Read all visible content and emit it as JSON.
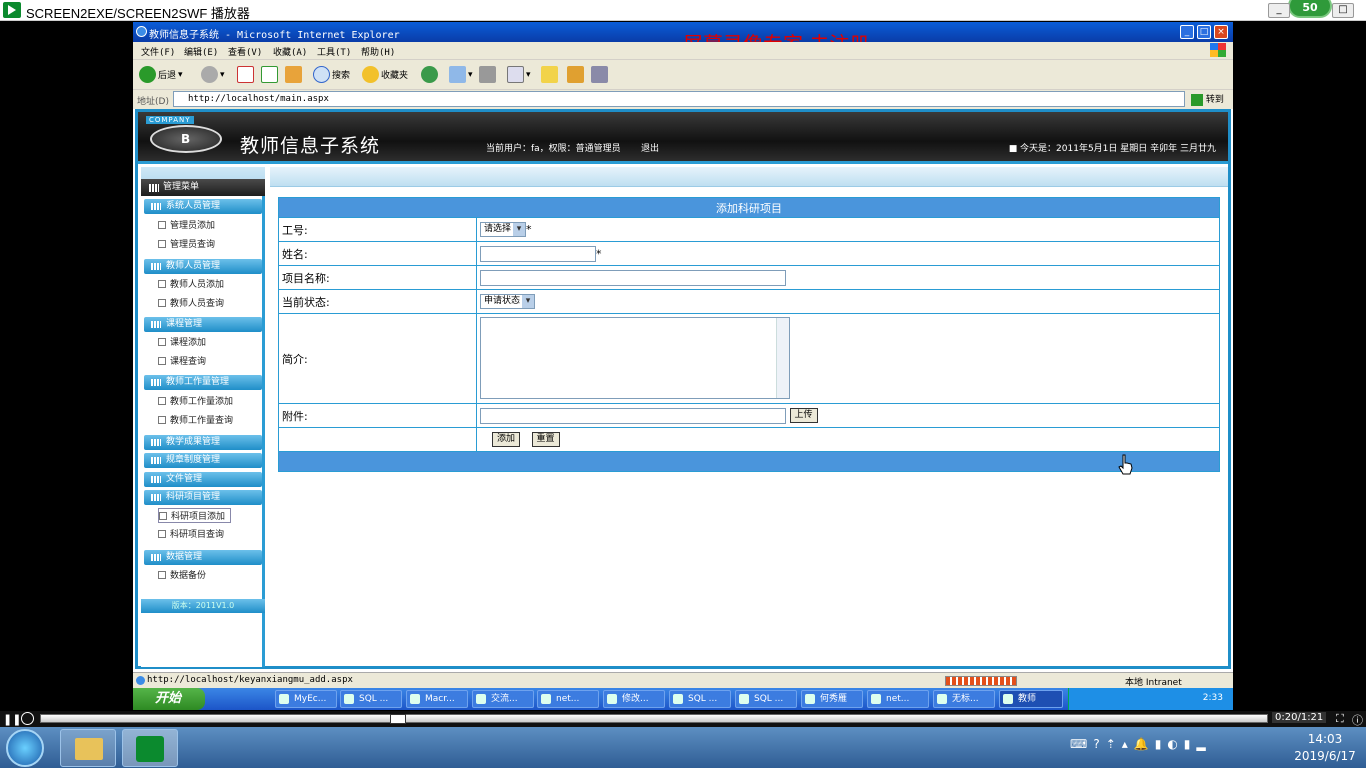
{
  "player": {
    "title": "SCREEN2EXE/SCREEN2SWF 播放器",
    "badge": "50",
    "time": "0:20/1:21"
  },
  "ie": {
    "title": "教师信息子系统 - Microsoft Internet Explorer",
    "watermark": "屏幕录像专家  未注册",
    "menu": [
      "文件(F)",
      "编辑(E)",
      "查看(V)",
      "收藏(A)",
      "工具(T)",
      "帮助(H)"
    ],
    "toolbar": {
      "back": "后退",
      "search": "搜索",
      "favorites": "收藏夹"
    },
    "address_label": "地址(D)",
    "address": "http://localhost/main.aspx",
    "go": "转到",
    "status_url": "http://localhost/keyanxiangmu_add.aspx",
    "status_zone": "本地 Intranet"
  },
  "app": {
    "company": "COMPANY",
    "title": "教师信息子系统",
    "user_info": "当前用户：fa，权限：普通管理员",
    "logout": "退出",
    "today": "■ 今天是：2011年5月1日 星期日 辛卯年 三月廿九",
    "menu_head": "管理菜单",
    "sections": [
      {
        "label": "系统人员管理",
        "items": [
          "管理员添加",
          "管理员查询"
        ]
      },
      {
        "label": "教师人员管理",
        "items": [
          "教师人员添加",
          "教师人员查询"
        ]
      },
      {
        "label": "课程管理",
        "items": [
          "课程添加",
          "课程查询"
        ]
      },
      {
        "label": "教师工作量管理",
        "items": [
          "教师工作量添加",
          "教师工作量查询"
        ]
      },
      {
        "label": "教学成果管理",
        "items": []
      },
      {
        "label": "规章制度管理",
        "items": []
      },
      {
        "label": "文件管理",
        "items": []
      },
      {
        "label": "科研项目管理",
        "items": [
          "科研项目添加",
          "科研项目查询"
        ]
      },
      {
        "label": "数据管理",
        "items": [
          "数据备份"
        ]
      }
    ],
    "version": "版本：2011V1.0"
  },
  "form": {
    "header": "添加科研项目",
    "gonghao_label": "工号:",
    "gonghao_select": "请选择",
    "xingming_label": "姓名:",
    "xiangmu_label": "项目名称:",
    "zhuangtai_label": "当前状态:",
    "zhuangtai_select": "申请状态",
    "jianjie_label": "简介:",
    "fujian_label": "附件:",
    "upload": "上传",
    "add": "添加",
    "reset": "重置",
    "required": "*"
  },
  "xp_taskbar": {
    "start": "开始",
    "tasks": [
      "MyEc...",
      "SQL ...",
      "Macr...",
      "交流...",
      "net...",
      "修改...",
      "SQL ...",
      "SQL ...",
      "何秀雁",
      "net...",
      "无标...",
      "教师"
    ],
    "time": "2:33"
  },
  "win7": {
    "time": "14:03",
    "date": "2019/6/17"
  }
}
